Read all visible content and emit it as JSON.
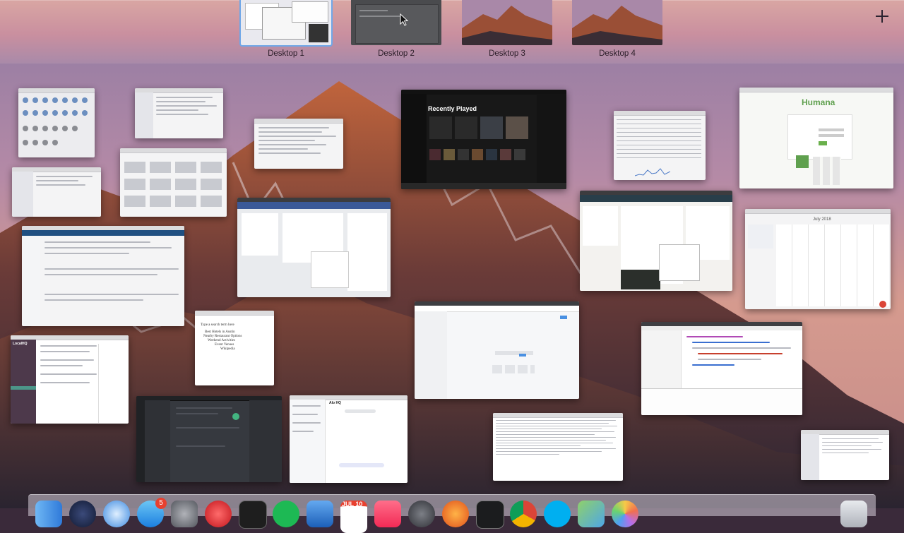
{
  "spaces": {
    "desktops": [
      {
        "label": "Desktop 1"
      },
      {
        "label": "Desktop 2"
      },
      {
        "label": "Desktop 3"
      },
      {
        "label": "Desktop 4"
      }
    ],
    "add_icon": "plus-icon"
  },
  "windows": {
    "spotify": {
      "heading": "Recently Played"
    },
    "humana": {
      "brand": "Humana"
    },
    "pages": {
      "lines": [
        "Type a search term here",
        "Best Hotels in Austin",
        "Nearby Restaurant Options",
        "Weekend Activities",
        "Event Venues",
        "Wikipedia"
      ]
    },
    "slack": {
      "team": "LocalHQ"
    },
    "tweetbot": {
      "title": "Alo HQ"
    },
    "calendar": {
      "month": "July 2018"
    }
  },
  "dock": {
    "badges": {
      "appstore": "5",
      "calendar_date": "JUL 10"
    },
    "icons": [
      "finder-icon",
      "launchpad-icon",
      "safari-icon",
      "appstore-icon",
      "system-preferences-icon",
      "opera-icon",
      "terminal-icon",
      "spotify-icon",
      "xcode-icon",
      "calendar-icon",
      "music-icon",
      "time-machine-icon",
      "firefox-icon",
      "activity-monitor-icon",
      "chrome-icon",
      "skype-icon",
      "maps-icon",
      "photos-icon",
      "trash-icon"
    ]
  },
  "colors": {
    "selected_outline": "#6fa7e8",
    "badge": "#e8402f",
    "spotify_green": "#1db954"
  }
}
